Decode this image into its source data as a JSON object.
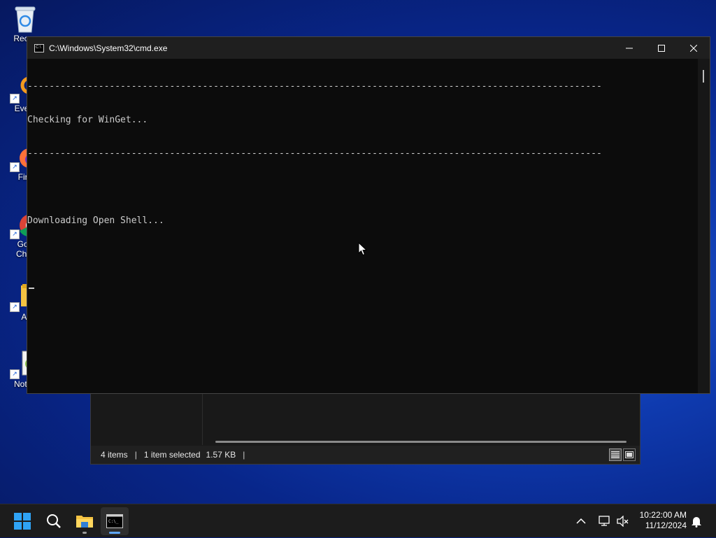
{
  "desktop": {
    "icons": [
      {
        "label": "Recyc"
      },
      {
        "label": "Every"
      },
      {
        "label": "Fire"
      },
      {
        "label": "Goo\nChro"
      },
      {
        "label": "At"
      },
      {
        "label": "Notep"
      }
    ]
  },
  "explorer": {
    "status": {
      "items": "4 items",
      "selected": "1 item selected",
      "size": "1.57 KB"
    }
  },
  "cmd": {
    "title": "C:\\Windows\\System32\\cmd.exe",
    "lines": [
      "---------------------------------------------------------------------------------------------------------",
      "Checking for WinGet...",
      "---------------------------------------------------------------------------------------------------------",
      "",
      "Downloading Open Shell..."
    ],
    "controls": {
      "minimize": "—",
      "maximize": "☐",
      "close": "✕"
    }
  },
  "taskbar": {
    "apps": [
      {
        "name": "start",
        "icon": "windows-logo-icon"
      },
      {
        "name": "search",
        "icon": "search-icon"
      },
      {
        "name": "file-explorer",
        "icon": "folder-icon"
      },
      {
        "name": "command-prompt",
        "icon": "terminal-icon"
      }
    ],
    "clock": {
      "time": "10:22:00 AM",
      "date": "11/12/2024"
    }
  },
  "colors": {
    "accent": "#60a8ff",
    "console_bg": "#0c0c0c",
    "console_fg": "#cccccc",
    "titlebar_bg": "#1f1f1f",
    "taskbar_bg": "#1c1c1c"
  }
}
